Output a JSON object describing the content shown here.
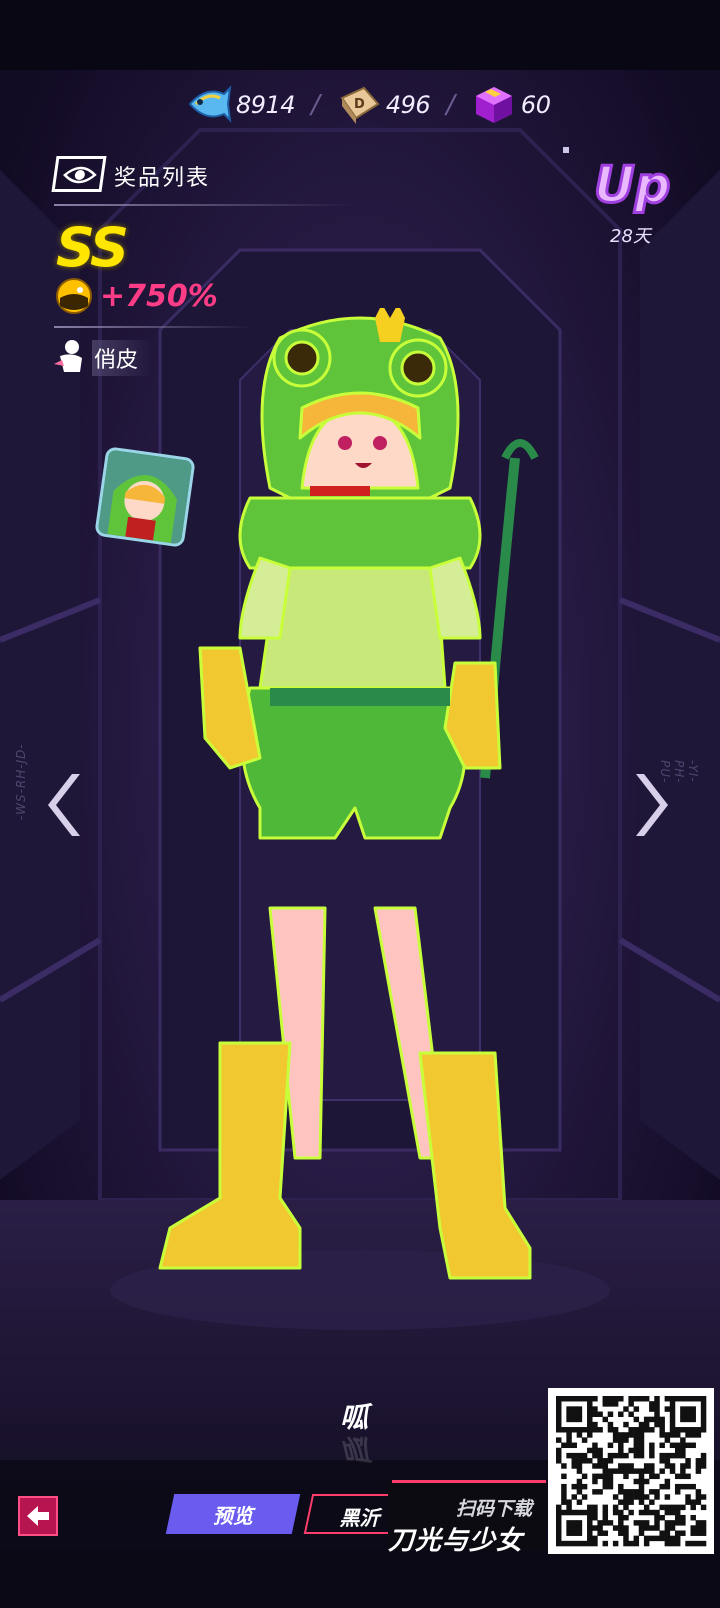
{
  "currencies": [
    {
      "icon": "fish-icon",
      "value": "8914"
    },
    {
      "icon": "dice-coin-icon",
      "value": "496"
    },
    {
      "icon": "purple-cube-icon",
      "value": "60"
    }
  ],
  "separator": "/",
  "prize": {
    "title": "奖品列表",
    "icon": "eye-icon"
  },
  "character": {
    "rank": "SS",
    "bonus": "+750%",
    "trait": "俏皮"
  },
  "event": {
    "badge": "Up",
    "days": "28天"
  },
  "side_codes": {
    "left": "-WS-RH-JD-",
    "right": "-YI-PH-PU-"
  },
  "voice_line": "呱",
  "tabs": {
    "preview": "预览",
    "black": "黑沂"
  },
  "download": {
    "scan": "扫码下载",
    "game": "刀光与少女"
  },
  "colors": {
    "accent_pink": "#ff3d86",
    "rank_yellow": "#ffe600",
    "tab_purple": "#6b5cf0",
    "frog_green": "#5fc43a"
  }
}
